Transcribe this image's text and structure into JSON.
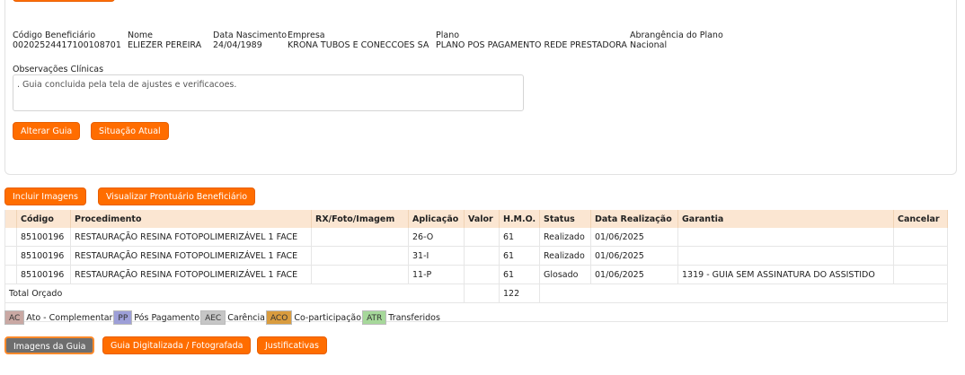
{
  "beneficiary": {
    "codigo_label": "Código Beneficiário",
    "codigo_value": "00202524417100108701",
    "nome_label": "Nome",
    "nome_value": "ELIEZER PEREIRA",
    "nascimento_label": "Data Nascimento",
    "nascimento_value": "24/04/1989",
    "empresa_label": "Empresa",
    "empresa_value": "KRONA TUBOS E CONECCOES SA",
    "plano_label": "Plano",
    "plano_value": "PLANO POS PAGAMENTO REDE PRESTADORA",
    "abrangencia_label": "Abrangência do Plano",
    "abrangencia_value": "Nacional"
  },
  "observacoes": {
    "label": "Observações Clínicas",
    "text": ". Guia concluida pela tela de ajustes e verificacoes."
  },
  "actions": {
    "alterar_guia": "Alterar Guia",
    "situacao_atual": "Situação Atual",
    "incluir_imagens": "Incluir Imagens",
    "visualizar_prontuario": "Visualizar Prontuário Beneficiário"
  },
  "table": {
    "headers": [
      "Código",
      "Procedimento",
      "RX/Foto/Imagem",
      "Aplicação",
      "Valor",
      "H.M.O.",
      "Status",
      "Data Realização",
      "Garantia",
      "Cancelar"
    ],
    "rows": [
      {
        "codigo": "85100196",
        "procedimento": "RESTAURAÇÃO RESINA FOTOPOLIMERIZÁVEL 1 FACE",
        "rx": "",
        "aplicacao": "26-O",
        "valor": "",
        "hmo": "61",
        "status": "Realizado",
        "data": "01/06/2025",
        "garantia": "",
        "cancelar": ""
      },
      {
        "codigo": "85100196",
        "procedimento": "RESTAURAÇÃO RESINA FOTOPOLIMERIZÁVEL 1 FACE",
        "rx": "",
        "aplicacao": "31-I",
        "valor": "",
        "hmo": "61",
        "status": "Realizado",
        "data": "01/06/2025",
        "garantia": "",
        "cancelar": ""
      },
      {
        "codigo": "85100196",
        "procedimento": "RESTAURAÇÃO RESINA FOTOPOLIMERIZÁVEL 1 FACE",
        "rx": "",
        "aplicacao": "11-P",
        "valor": "",
        "hmo": "61",
        "status": "Glosado",
        "data": "01/06/2025",
        "garantia": "1319 - GUIA SEM ASSINATURA DO ASSISTIDO",
        "cancelar": ""
      }
    ],
    "total_label": "Total Orçado",
    "total_hmo": "122"
  },
  "legend": [
    {
      "code": "AC",
      "label": "Ato - Complementar",
      "color": "#c9a8a3"
    },
    {
      "code": "PP",
      "label": "Pós Pagamento",
      "color": "#9d9fd8"
    },
    {
      "code": "AEC",
      "label": "Carência",
      "color": "#c6c6c6"
    },
    {
      "code": "ACO",
      "label": "Co-participação",
      "color": "#d99c3f"
    },
    {
      "code": "ATR",
      "label": "Transferidos",
      "color": "#a6d89a"
    }
  ],
  "bottom_buttons": {
    "imagens_guia": "Imagens da Guia",
    "guia_digitalizada": "Guia Digitalizada / Fotografada",
    "justificativas": "Justificativas"
  },
  "colors": {
    "accent": "#ff6d00",
    "header_bg": "#fbe6d2"
  }
}
